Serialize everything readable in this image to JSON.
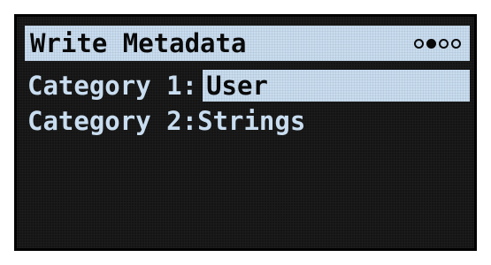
{
  "header": {
    "title": "Write Metadata",
    "page_indicator": {
      "total_pages": 4,
      "current_page": 2
    }
  },
  "parameters": [
    {
      "label": "Category 1:",
      "value": "User",
      "selected": true
    },
    {
      "label": "Category 2:",
      "value": "Strings",
      "selected": false
    }
  ],
  "colors": {
    "screen_background": "#141414",
    "highlight": "#c9ddf0",
    "text_dark": "#0a0a0a"
  }
}
